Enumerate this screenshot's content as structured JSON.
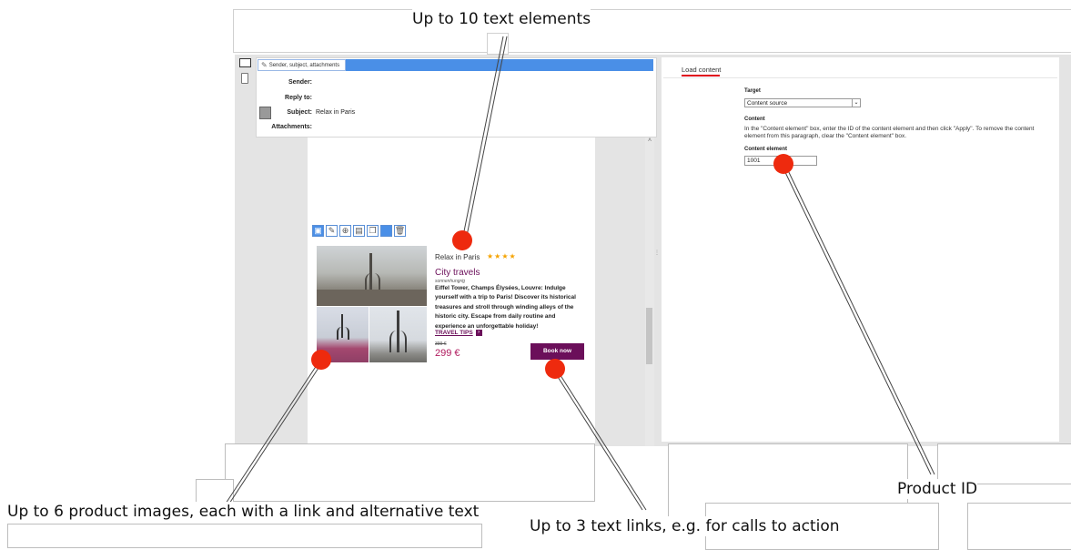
{
  "callouts": {
    "text_elements": "Up to 10 text elements",
    "product_images": "Up to 6 product images, each with a link and alternative text",
    "text_links": "Up to 3 text links, e.g. for calls to action",
    "product_id": "Product ID"
  },
  "editor": {
    "header_tab": "Sender, subject, attachments",
    "fields": [
      {
        "label": "Sender:",
        "value": ""
      },
      {
        "label": "Reply to:",
        "value": ""
      },
      {
        "label": "Subject:",
        "value": "Relax in Paris"
      },
      {
        "label": "Attachments:",
        "value": ""
      }
    ],
    "product": {
      "name": "Relax in Paris",
      "stars": "★★★★",
      "headline": "City travels",
      "subline": "sonnenhungrig",
      "description": "Eiffel Tower, Champs Élysées, Louvre: Indulge yourself with a trip to Paris! Discover its historical treasures and stroll through winding alleys of the historic city. Escape from daily routine and experience an unforgettable holiday!",
      "link_label": "TRAVEL TIPS",
      "old_price": "399 €",
      "price": "299 €",
      "cta_label": "Book now"
    }
  },
  "panel": {
    "tab": "Load content",
    "target_label": "Target",
    "target_select": "Content source",
    "content_label": "Content",
    "content_help": "In the \"Content element\" box, enter the ID of the content element and then click \"Apply\". To remove the content element from this paragraph, clear the \"Content element\" box.",
    "element_label": "Content element",
    "element_value": "1001"
  },
  "colors": {
    "accent_purple": "#6b0f5a",
    "selection_blue": "#4a8fe7",
    "marker_red": "#ee2a0e",
    "tab_underline": "#e0001a"
  }
}
